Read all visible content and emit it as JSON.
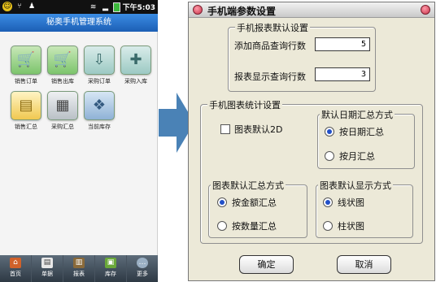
{
  "phone": {
    "status_time": "下午5:03",
    "app_title": "秘奥手机管理系统",
    "tiles": [
      {
        "label": "销售订单",
        "icon": "stroller-icon"
      },
      {
        "label": "销售出库",
        "icon": "stroller-icon"
      },
      {
        "label": "采购订单",
        "icon": "cart-icon"
      },
      {
        "label": "采购入库",
        "icon": "cart-plus-icon"
      },
      {
        "label": "销售汇总",
        "icon": "folder-icon"
      },
      {
        "label": "采购汇总",
        "icon": "calculator-icon"
      },
      {
        "label": "当前库存",
        "icon": "boxes-icon"
      }
    ],
    "tabs": [
      {
        "label": "首页",
        "icon": "home-icon"
      },
      {
        "label": "单据",
        "icon": "document-icon"
      },
      {
        "label": "报表",
        "icon": "books-icon"
      },
      {
        "label": "库存",
        "icon": "inventory-icon"
      },
      {
        "label": "更多",
        "icon": "more-icon"
      }
    ]
  },
  "dialog": {
    "title": "手机端参数设置",
    "report_defaults": {
      "group_title": "手机报表默认设置",
      "product_rows_label": "添加商品查询行数",
      "product_rows_value": "5",
      "report_rows_label": "报表显示查询行数",
      "report_rows_value": "3"
    },
    "chart_settings": {
      "group_title": "手机图表统计设置",
      "default_2d_label": "图表默认2D",
      "default_2d_checked": false
    },
    "date_summary": {
      "group_title": "默认日期汇总方式",
      "options": [
        "按日期汇总",
        "按月汇总"
      ],
      "selected": 0
    },
    "summary_mode": {
      "group_title": "图表默认汇总方式",
      "options": [
        "按金额汇总",
        "按数量汇总"
      ],
      "selected": 0
    },
    "display_mode": {
      "group_title": "图表默认显示方式",
      "options": [
        "线状图",
        "柱状图"
      ],
      "selected": 0
    },
    "ok_label": "确定",
    "cancel_label": "取消"
  },
  "colors": {
    "dialog_bg": "#ece9d8",
    "phone_titlebar": "#2a78d0",
    "arrow": "#4a82b6",
    "radio_selected": "#2250c8"
  }
}
